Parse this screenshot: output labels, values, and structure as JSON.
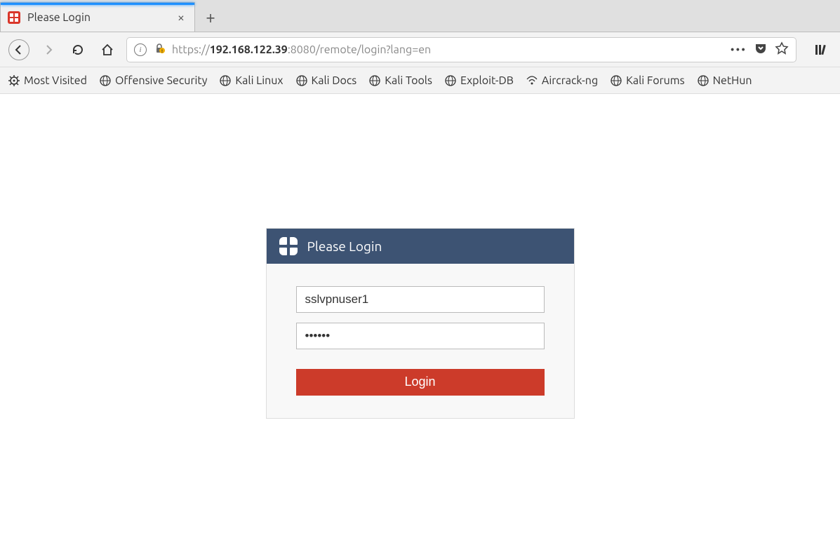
{
  "tab": {
    "title": "Please Login",
    "close_glyph": "×",
    "newtab_glyph": "+"
  },
  "url": {
    "scheme": "https://",
    "host": "192.168.122.39",
    "port_path": ":8080/remote/login?lang=en",
    "info_glyph": "i",
    "more_glyph": "•••"
  },
  "bookmarks": [
    {
      "name": "most-visited",
      "label": "Most Visited",
      "icon": "gear"
    },
    {
      "name": "offensive-security",
      "label": "Offensive Security",
      "icon": "globe"
    },
    {
      "name": "kali-linux",
      "label": "Kali Linux",
      "icon": "globe"
    },
    {
      "name": "kali-docs",
      "label": "Kali Docs",
      "icon": "globe"
    },
    {
      "name": "kali-tools",
      "label": "Kali Tools",
      "icon": "globe"
    },
    {
      "name": "exploit-db",
      "label": "Exploit-DB",
      "icon": "globe"
    },
    {
      "name": "aircrack-ng",
      "label": "Aircrack-ng",
      "icon": "wifi"
    },
    {
      "name": "kali-forums",
      "label": "Kali Forums",
      "icon": "globe"
    },
    {
      "name": "nethunter",
      "label": "NetHun",
      "icon": "globe"
    }
  ],
  "login": {
    "title": "Please Login",
    "username": "sslvpnuser1",
    "password": "••••••",
    "button_label": "Login"
  }
}
